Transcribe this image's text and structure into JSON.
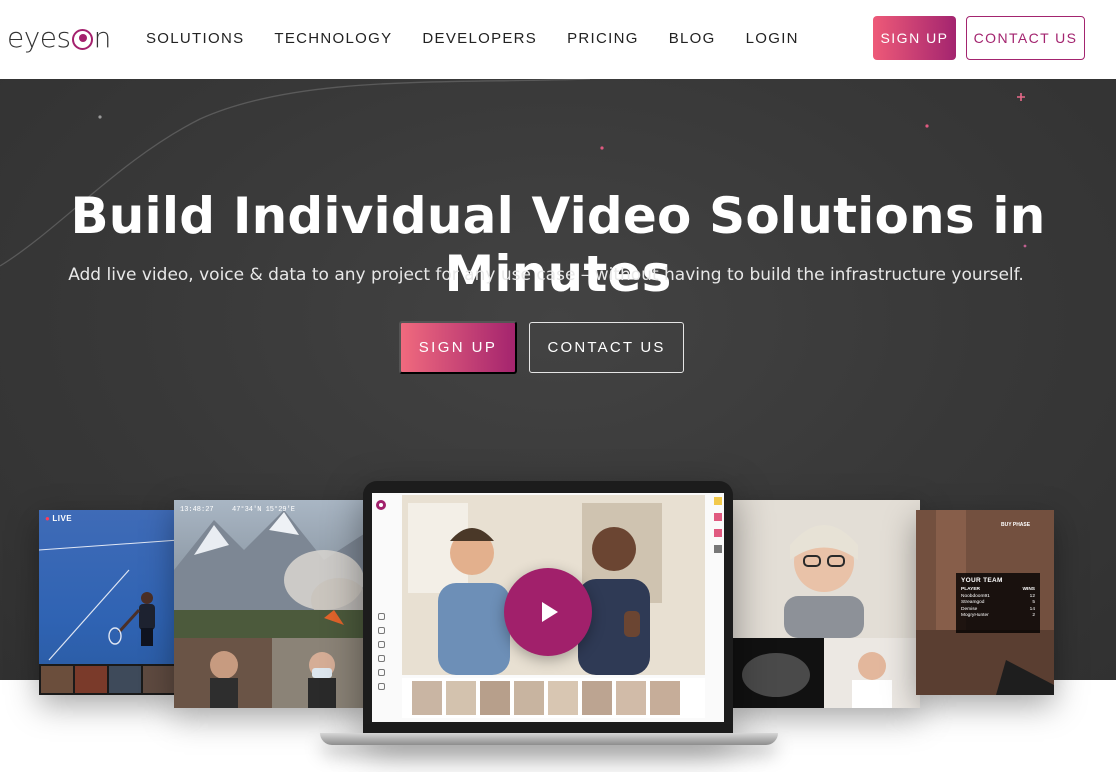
{
  "header": {
    "logo_text_left": "eyes",
    "logo_text_right": "n",
    "nav": [
      {
        "label": "SOLUTIONS"
      },
      {
        "label": "TECHNOLOGY"
      },
      {
        "label": "DEVELOPERS"
      },
      {
        "label": "PRICING"
      },
      {
        "label": "BLOG"
      },
      {
        "label": "LOGIN"
      }
    ],
    "signup_label": "SIGN UP",
    "contact_label": "CONTACT US"
  },
  "hero": {
    "title": "Build Individual Video Solutions in Minutes",
    "subtitle": "Add live video, voice & data to any project for any use case – without having to build the infrastructure yourself.",
    "signup_label": "SIGN UP",
    "contact_label": "CONTACT US"
  },
  "collage": {
    "live_badge": "LIVE",
    "wildfire_time": "13:48:27",
    "wildfire_coords": "47°34'N 15°29'E",
    "team_title": "YOUR TEAM",
    "team_header": [
      "PLAYER",
      "WINS"
    ],
    "team_rows": [
      [
        "Noobdoom91",
        "12"
      ],
      [
        "Streamgod",
        "5"
      ],
      [
        "Demise",
        "14"
      ],
      [
        "MogryHunter",
        "2"
      ]
    ],
    "buy_phase": "BUY PHASE"
  },
  "colors": {
    "brand": "#a3246f",
    "brand_light": "#ef5c79",
    "hero_bg": "#3a3a3a"
  },
  "icons": {
    "play": "play-icon",
    "record": "record-icon"
  }
}
